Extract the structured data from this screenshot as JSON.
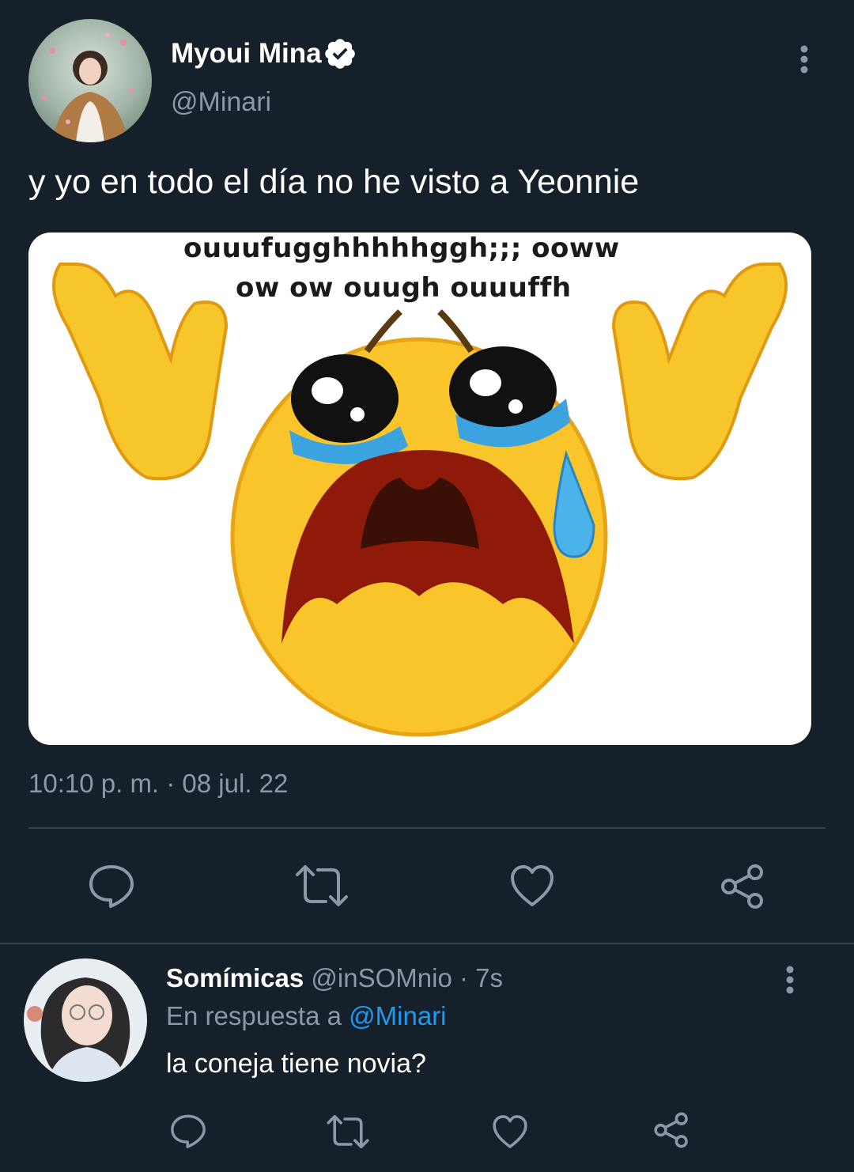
{
  "main_tweet": {
    "author_name": "Myoui Mina",
    "handle": "@Minari",
    "text": "y yo en todo el día no he visto a Yeonnie",
    "image_caption_line1": "ouuufugghhhhhggh;;; ooww",
    "image_caption_line2": "ow ow ouugh ouuuffh",
    "timestamp": "10:10 p. m. · 08 jul. 22"
  },
  "reply": {
    "author_name": "Somímicas",
    "handle_time": "@inSOMnio · 7s",
    "reply_prefix": "En respuesta a",
    "reply_to": "@Minari",
    "text": "la coneja tiene novia?"
  },
  "colors": {
    "background": "#15202b",
    "muted": "#8b98a5",
    "link": "#1d9bf0",
    "verified_badge": "#ffffff"
  },
  "icons": [
    "more-vertical-icon",
    "verified-icon",
    "reply-icon",
    "retweet-icon",
    "like-icon",
    "share-icon"
  ]
}
